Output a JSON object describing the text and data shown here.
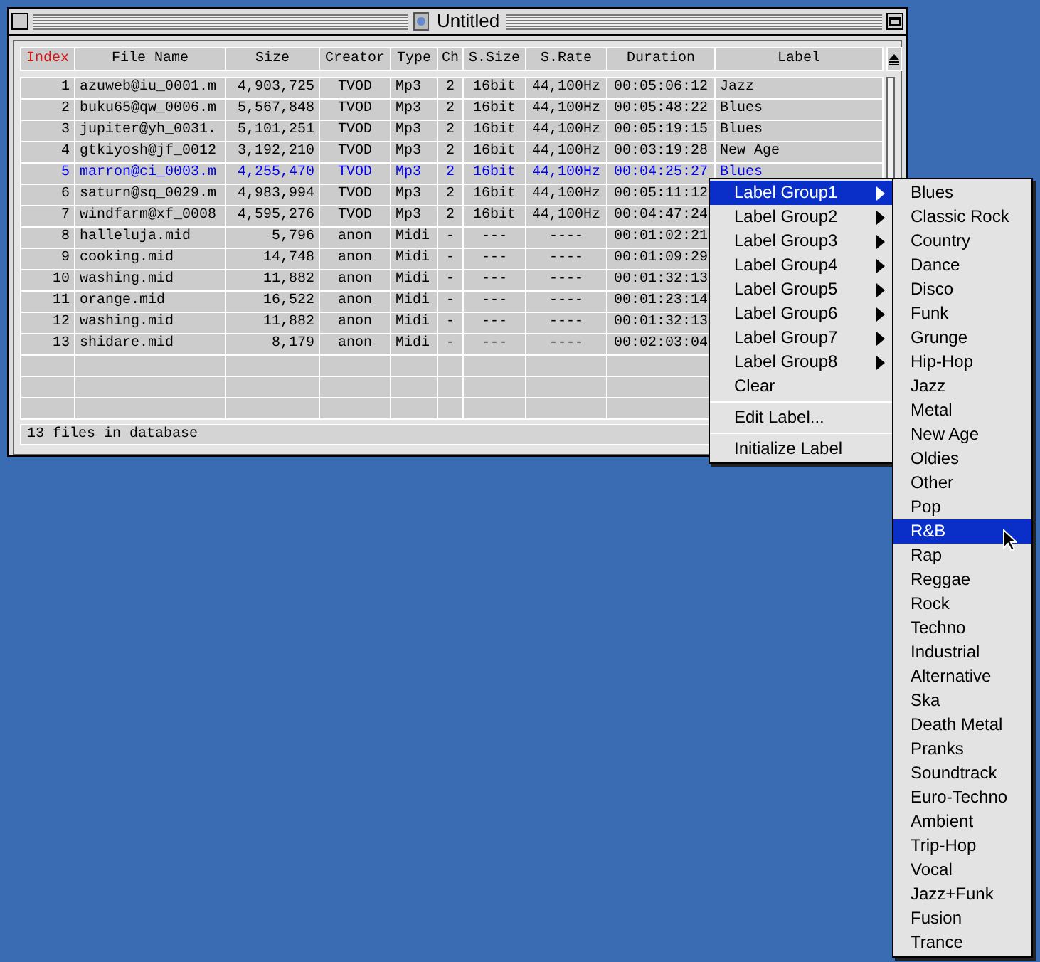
{
  "window": {
    "title": "Untitled",
    "table": {
      "columns": [
        {
          "label": "Index",
          "sorted": true
        },
        {
          "label": "File Name",
          "sorted": false
        },
        {
          "label": "Size",
          "sorted": false
        },
        {
          "label": "Creator",
          "sorted": false
        },
        {
          "label": "Type",
          "sorted": false
        },
        {
          "label": "Ch",
          "sorted": false
        },
        {
          "label": "S.Size",
          "sorted": false
        },
        {
          "label": "S.Rate",
          "sorted": false
        },
        {
          "label": "Duration",
          "sorted": false
        },
        {
          "label": "Label",
          "sorted": false
        }
      ],
      "rows": [
        {
          "selected": false,
          "cells": [
            "1",
            "azuweb@iu_0001.m",
            "4,903,725",
            "TVOD",
            "Mp3",
            "2",
            "16bit",
            "44,100Hz",
            "00:05:06:12",
            "Jazz"
          ]
        },
        {
          "selected": false,
          "cells": [
            "2",
            "buku65@qw_0006.m",
            "5,567,848",
            "TVOD",
            "Mp3",
            "2",
            "16bit",
            "44,100Hz",
            "00:05:48:22",
            "Blues"
          ]
        },
        {
          "selected": false,
          "cells": [
            "3",
            "jupiter@yh_0031.",
            "5,101,251",
            "TVOD",
            "Mp3",
            "2",
            "16bit",
            "44,100Hz",
            "00:05:19:15",
            "Blues"
          ]
        },
        {
          "selected": false,
          "cells": [
            "4",
            "gtkiyosh@jf_0012",
            "3,192,210",
            "TVOD",
            "Mp3",
            "2",
            "16bit",
            "44,100Hz",
            "00:03:19:28",
            "New Age"
          ]
        },
        {
          "selected": true,
          "cells": [
            "5",
            "marron@ci_0003.m",
            "4,255,470",
            "TVOD",
            "Mp3",
            "2",
            "16bit",
            "44,100Hz",
            "00:04:25:27",
            "Blues"
          ]
        },
        {
          "selected": false,
          "cells": [
            "6",
            "saturn@sq_0029.m",
            "4,983,994",
            "TVOD",
            "Mp3",
            "2",
            "16bit",
            "44,100Hz",
            "00:05:11:12"
          ]
        },
        {
          "selected": false,
          "cells": [
            "7",
            "windfarm@xf_0008",
            "4,595,276",
            "TVOD",
            "Mp3",
            "2",
            "16bit",
            "44,100Hz",
            "00:04:47:24"
          ]
        },
        {
          "selected": false,
          "cells": [
            "8",
            "halleluja.mid",
            "5,796",
            "anon",
            "Midi",
            "-",
            "---",
            "----",
            "00:01:02:21"
          ]
        },
        {
          "selected": false,
          "cells": [
            "9",
            "cooking.mid",
            "14,748",
            "anon",
            "Midi",
            "-",
            "---",
            "----",
            "00:01:09:29"
          ]
        },
        {
          "selected": false,
          "cells": [
            "10",
            "washing.mid",
            "11,882",
            "anon",
            "Midi",
            "-",
            "---",
            "----",
            "00:01:32:13"
          ]
        },
        {
          "selected": false,
          "cells": [
            "11",
            "orange.mid",
            "16,522",
            "anon",
            "Midi",
            "-",
            "---",
            "----",
            "00:01:23:14"
          ]
        },
        {
          "selected": false,
          "cells": [
            "12",
            "washing.mid",
            "11,882",
            "anon",
            "Midi",
            "-",
            "---",
            "----",
            "00:01:32:13"
          ]
        },
        {
          "selected": false,
          "cells": [
            "13",
            "shidare.mid",
            "8,179",
            "anon",
            "Midi",
            "-",
            "---",
            "----",
            "00:02:03:04"
          ]
        }
      ]
    },
    "status_bar": "13 files in database"
  },
  "context_menu": {
    "items": [
      {
        "kind": "submenu",
        "label": "Label Group1",
        "selected": true
      },
      {
        "kind": "submenu",
        "label": "Label Group2",
        "selected": false
      },
      {
        "kind": "submenu",
        "label": "Label Group3",
        "selected": false
      },
      {
        "kind": "submenu",
        "label": "Label Group4",
        "selected": false
      },
      {
        "kind": "submenu",
        "label": "Label Group5",
        "selected": false
      },
      {
        "kind": "submenu",
        "label": "Label Group6",
        "selected": false
      },
      {
        "kind": "submenu",
        "label": "Label Group7",
        "selected": false
      },
      {
        "kind": "submenu",
        "label": "Label Group8",
        "selected": false
      },
      {
        "kind": "item",
        "label": "Clear",
        "selected": false
      },
      {
        "kind": "separator"
      },
      {
        "kind": "item",
        "label": "Edit Label...",
        "selected": false
      },
      {
        "kind": "separator"
      },
      {
        "kind": "item",
        "label": "Initialize Label",
        "selected": false
      }
    ]
  },
  "submenu": {
    "items": [
      {
        "label": "Blues",
        "selected": false
      },
      {
        "label": "Classic Rock",
        "selected": false
      },
      {
        "label": "Country",
        "selected": false
      },
      {
        "label": "Dance",
        "selected": false
      },
      {
        "label": "Disco",
        "selected": false
      },
      {
        "label": "Funk",
        "selected": false
      },
      {
        "label": "Grunge",
        "selected": false
      },
      {
        "label": "Hip-Hop",
        "selected": false
      },
      {
        "label": "Jazz",
        "selected": false
      },
      {
        "label": "Metal",
        "selected": false
      },
      {
        "label": "New Age",
        "selected": false
      },
      {
        "label": "Oldies",
        "selected": false
      },
      {
        "label": "Other",
        "selected": false
      },
      {
        "label": "Pop",
        "selected": false
      },
      {
        "label": "R&B",
        "selected": true
      },
      {
        "label": "Rap",
        "selected": false
      },
      {
        "label": "Reggae",
        "selected": false
      },
      {
        "label": "Rock",
        "selected": false
      },
      {
        "label": "Techno",
        "selected": false
      },
      {
        "label": "Industrial",
        "selected": false
      },
      {
        "label": "Alternative",
        "selected": false
      },
      {
        "label": "Ska",
        "selected": false
      },
      {
        "label": "Death Metal",
        "selected": false
      },
      {
        "label": "Pranks",
        "selected": false
      },
      {
        "label": "Soundtrack",
        "selected": false
      },
      {
        "label": "Euro-Techno",
        "selected": false
      },
      {
        "label": "Ambient",
        "selected": false
      },
      {
        "label": "Trip-Hop",
        "selected": false
      },
      {
        "label": "Vocal",
        "selected": false
      },
      {
        "label": "Jazz+Funk",
        "selected": false
      },
      {
        "label": "Fusion",
        "selected": false
      },
      {
        "label": "Trance",
        "selected": false
      }
    ]
  }
}
